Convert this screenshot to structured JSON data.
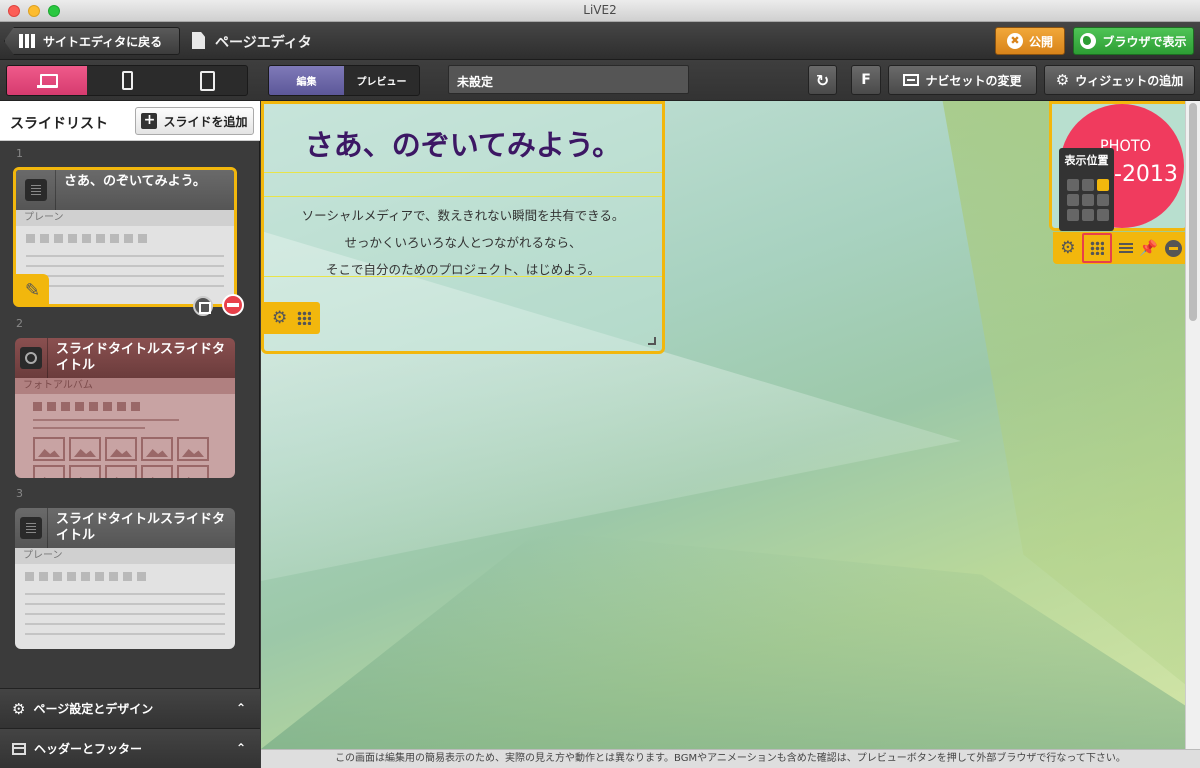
{
  "window": {
    "title": "LiVE2"
  },
  "toolbar": {
    "back_label": "サイトエディタに戻る",
    "page_title": "ページエディタ",
    "publish_label": "公開",
    "browser_label": "ブラウザで表示"
  },
  "toolbar2": {
    "modes": [
      "編集",
      "プレビュー"
    ],
    "active_mode": "編集",
    "page_name": "未設定",
    "f_label": "F",
    "navset_label": "ナビセットの変更",
    "widget_label": "ウィジェットの追加",
    "devices": [
      "desktop",
      "phone",
      "tablet"
    ],
    "active_device": "desktop"
  },
  "sidebar": {
    "title": "スライドリスト",
    "add_label": "スライドを追加",
    "slides": [
      {
        "num": "1",
        "title": "さあ、のぞいてみよう。",
        "type": "プレーン",
        "icon": "document-icon",
        "selected": true
      },
      {
        "num": "2",
        "title": "スライドタイトルスライドタイトル",
        "type": "フォトアルバム",
        "icon": "camera-icon",
        "selected": false
      },
      {
        "num": "3",
        "title": "スライドタイトルスライドタイトル",
        "type": "プレーン",
        "icon": "document-icon",
        "selected": false
      }
    ],
    "panels": [
      "ページ設定とデザイン",
      "ヘッダーとフッター"
    ]
  },
  "canvas": {
    "hero": {
      "title": "さあ、のぞいてみよう。",
      "lines": [
        "ソーシャルメディアで、数えきれない瞬間を共有できる。",
        "せっかくいろいろな人とつながれるなら、",
        "そこで自分のためのプロジェクト、はじめよう。"
      ]
    },
    "photo_widget": {
      "text": "PHOTO",
      "year": "-2013"
    },
    "position_popup": {
      "title": "表示位置",
      "selected_cell": 2
    }
  },
  "footer_notice": "この画面は編集用の簡易表示のため、実際の見え方や動作とは異なります。BGMやアニメーションも含めた確認は、プレビューボタンを押して外部ブラウザで行なって下さい。",
  "colors": {
    "accent": "#f2b70d",
    "pink": "#e84a7f",
    "green": "#3cb043",
    "orange": "#e8922a",
    "purple": "#6b67a8"
  }
}
